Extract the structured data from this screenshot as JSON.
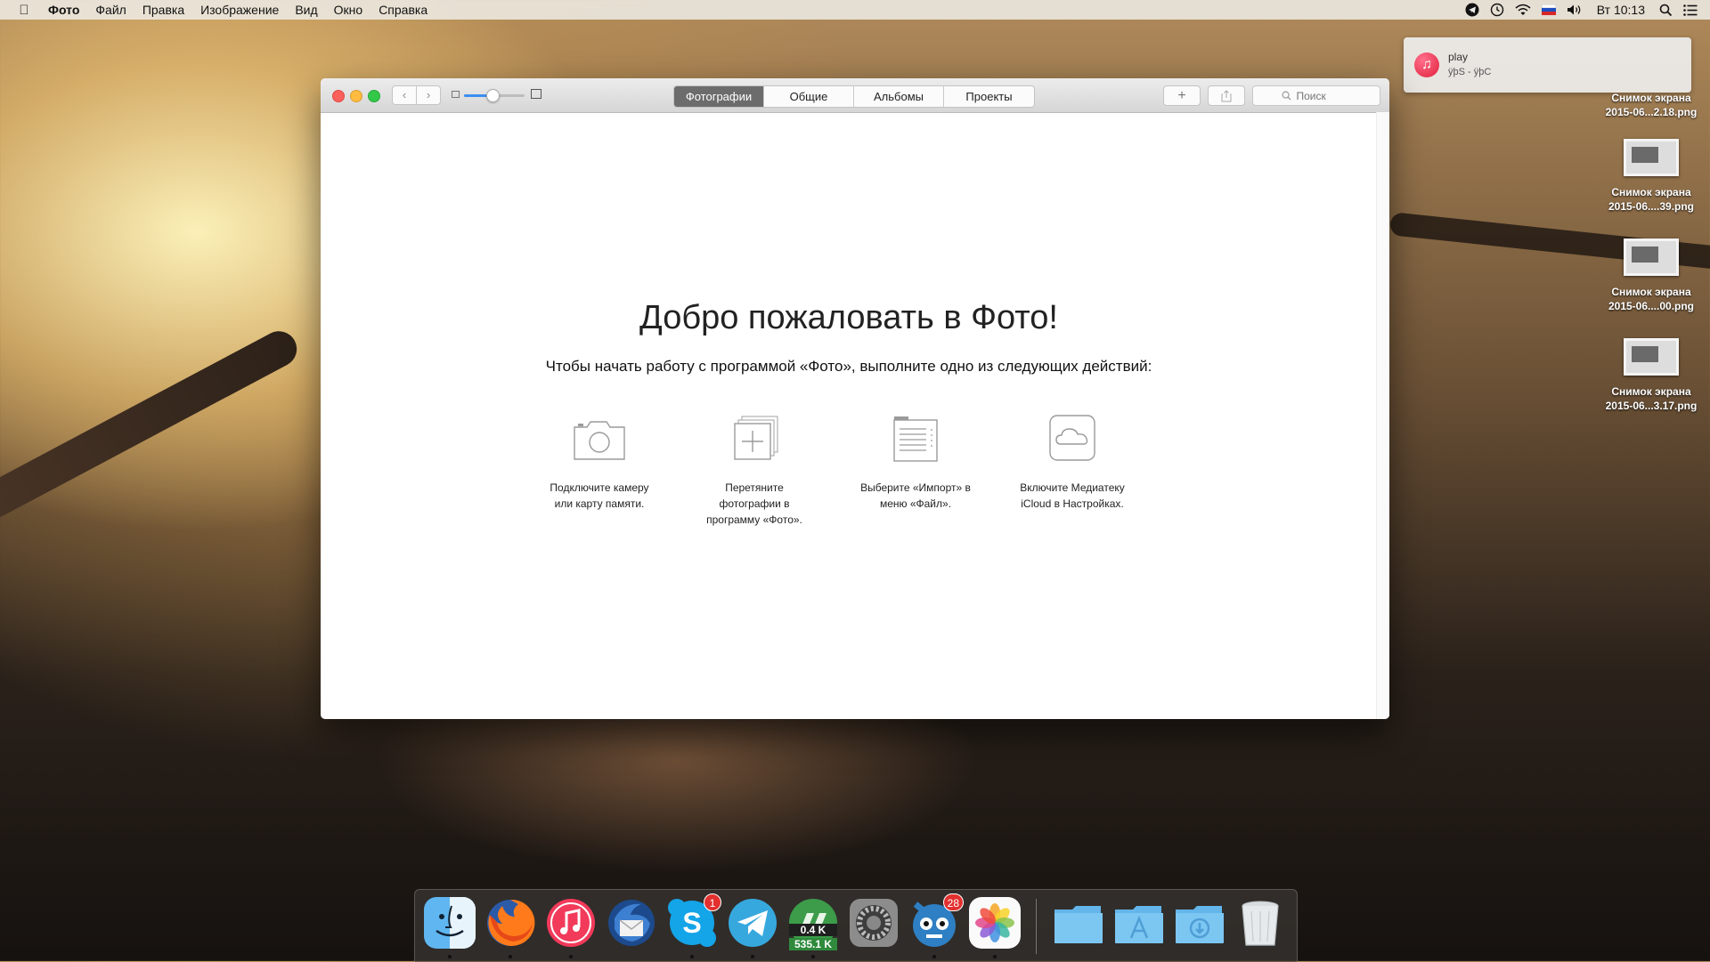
{
  "menubar": {
    "app_name": "Фото",
    "items": [
      "Файл",
      "Правка",
      "Изображение",
      "Вид",
      "Окно",
      "Справка"
    ],
    "clock": "Вт 10:13",
    "status_icons": [
      "telegram-icon",
      "time-machine-icon",
      "wifi-icon",
      "flag-ru-icon",
      "volume-icon",
      "spotlight-icon",
      "notification-center-icon"
    ]
  },
  "notification": {
    "title": "play",
    "subtitle": "ÿþS - ÿþC",
    "icon": "itunes-icon"
  },
  "desktop_files": [
    {
      "line1": "Снимок экрана",
      "line2": "2015-06...2.18.png"
    },
    {
      "line1": "Снимок экрана",
      "line2": "2015-06....39.png"
    },
    {
      "line1": "Снимок экрана",
      "line2": "2015-06....00.png"
    },
    {
      "line1": "Снимок экрана",
      "line2": "2015-06...3.17.png"
    }
  ],
  "window": {
    "tabs": [
      {
        "label": "Фотографии",
        "active": true
      },
      {
        "label": "Общие",
        "active": false
      },
      {
        "label": "Альбомы",
        "active": false
      },
      {
        "label": "Проекты",
        "active": false
      }
    ],
    "add_label": "+",
    "search_placeholder": "Поиск",
    "zoom_level": 0.45,
    "welcome_title": "Добро пожаловать в Фото!",
    "welcome_subtitle": "Чтобы начать работу с программой «Фото», выполните одно из следующих действий:",
    "options": [
      {
        "icon": "camera-icon",
        "lines": [
          "Подключите камеру",
          "или карту памяти."
        ]
      },
      {
        "icon": "drag-photos-icon",
        "lines": [
          "Перетяните",
          "фотографии в",
          "программу «Фото»."
        ]
      },
      {
        "icon": "import-menu-icon",
        "lines": [
          "Выберите «Импорт» в",
          "меню «Файл»."
        ]
      },
      {
        "icon": "icloud-icon",
        "lines": [
          "Включите Медиатеку",
          "iCloud в Настройках."
        ]
      }
    ]
  },
  "dock": {
    "apps": [
      {
        "name": "finder",
        "running": true
      },
      {
        "name": "firefox",
        "running": true
      },
      {
        "name": "itunes",
        "running": true
      },
      {
        "name": "thunderbird",
        "running": false
      },
      {
        "name": "skype",
        "running": true,
        "badge": "1"
      },
      {
        "name": "telegram",
        "running": true
      },
      {
        "name": "network-monitor",
        "running": true,
        "up": "0.4 K",
        "down": "535.1 K"
      },
      {
        "name": "system-preferences",
        "running": false
      },
      {
        "name": "tweetbot",
        "running": true,
        "badge": "28"
      },
      {
        "name": "photos",
        "running": true
      }
    ],
    "folders": [
      "documents-folder",
      "applications-folder",
      "downloads-folder",
      "trash"
    ]
  },
  "colors": {
    "accent": "#3b8ff0",
    "active_tab": "#6c6c6c",
    "badge": "#e3302f"
  }
}
